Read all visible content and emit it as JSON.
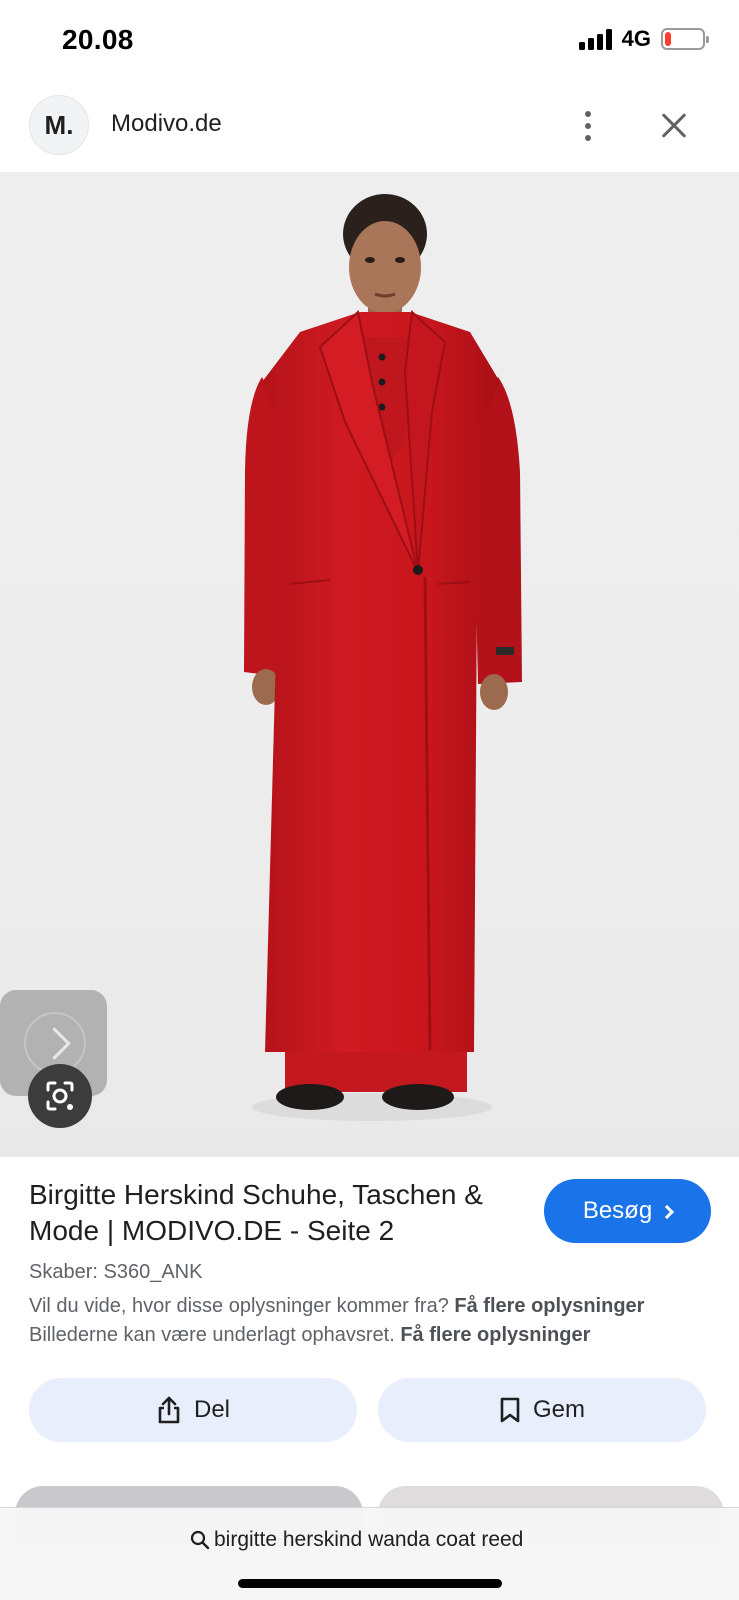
{
  "status_bar": {
    "time": "20.08",
    "network": "4G",
    "battery_level": 0.18,
    "battery_color": "#ff3b30"
  },
  "header": {
    "logo_text": "M.",
    "site_name": "Modivo.de",
    "more_icon": "more-vert-icon",
    "close_icon": "close-icon"
  },
  "image": {
    "next_icon": "chevron-right-icon",
    "lens_icon": "google-lens-icon"
  },
  "result": {
    "title": "Birgitte Herskind Schuhe, Taschen & Mode | MODIVO.DE - Seite 2",
    "visit_label": "Besøg",
    "creator": "Skaber: S360_ANK",
    "info_question": "Vil du vide, hvor disse oplysninger kommer fra?",
    "info_link_1": "Få flere oplysninger",
    "copyright_text": "Billederne kan være underlagt ophavsret.",
    "info_link_2": "Få flere oplysninger"
  },
  "actions": {
    "share_label": "Del",
    "share_icon": "share-icon",
    "save_label": "Gem",
    "save_icon": "bookmark-icon"
  },
  "bottom_bar": {
    "search_icon": "search-icon",
    "search_query": "birgitte herskind wanda coat reed"
  },
  "colors": {
    "accent": "#1a73e8",
    "action_bg": "#e8eefb",
    "coat_red": "#c8161d"
  }
}
